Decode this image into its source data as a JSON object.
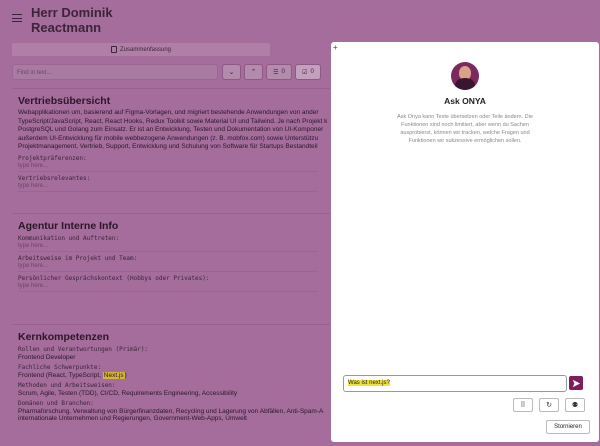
{
  "header": {
    "name_line1": "Herr Dominik",
    "name_line2": "Reactmann"
  },
  "toolbar": {
    "summary_label": "Zusammenfassung",
    "search_placeholder": "Find in text...",
    "list_count": "0",
    "check_count": "0"
  },
  "vertrieb": {
    "title": "Vertriebsübersicht",
    "lines": [
      "Webapplikationen um, basierend auf Figma-Vorlagen, und migriert bestehende Anwendungen von ander",
      "TypeScript/JavaScript, React, React Hooks, Redux Toolkit sowie Material UI und Tailwind. Je nach Projekt k",
      "PostgreSQL und Golang zum Einsatz. Er ist an Entwicklung, Testen und Dokumentation von UI-Komponer",
      "außerdem UI-Entwicklung für mobile webbezogene Anwendungen (z. B. mobfox.com) sowie Unterstützu",
      "Projektmanagement, Vertrieb, Support, Entwicklung und Schulung von Software für Startups Bestandteil"
    ],
    "label1": "Projektpräferenzen:",
    "ph1": "type here...",
    "label2": "Vertriebsrelevantes:",
    "ph2": "type here..."
  },
  "agentur": {
    "title": "Agentur Interne Info",
    "label1": "Kommunikation und Auftreten:",
    "ph1": "type here...",
    "label2": "Arbeitsweise im Projekt und Team:",
    "ph2": "type here...",
    "label3": "Persönlicher Gesprächskontext (Hobbys oder Privates):",
    "ph3": "type here..."
  },
  "kern": {
    "title": "Kernkompetenzen",
    "label1": "Rollen und Verantwortungen (Primär):",
    "val1": "Frontend Developer",
    "label2": "Fachliche Schwerpunkte:",
    "val2_prefix": "Frontend (React, TypeScript, ",
    "val2_highlight": "Next.js",
    "val2_suffix": ")",
    "label3": "Methoden und Arbeitsweisen:",
    "val3": "Scrum, Agile, Testen (TDD), CI/CD, Requirements Engineering, Accessibility",
    "label4": "Domänen und Branchen:",
    "val4": "Pharmaforschung, Verwaltung von Bürgerfinanzdaten, Recycling und Lagerung von Abfällen, Anti-Spam-A",
    "val5": "internationale Unternehmen und Regierungen, Government-Web-Apps, Umwelt"
  },
  "ask": {
    "title": "Ask ONYA",
    "description": "Ask Onya kann Texte übersetzen oder Teile ändern. Die Funktionen sind noch limitiert, aber wenn du Sachen ausprobierst, können wir tracken, welche Fragen und Funktionen wir sukzessive ermöglichen sollen.",
    "input_value": "Was ist next.js?",
    "cancel_label": "Stornieren"
  },
  "colors": {
    "overlay": "#a46d9c",
    "accent": "#7d1f5f",
    "highlight": "#d4b63a"
  }
}
